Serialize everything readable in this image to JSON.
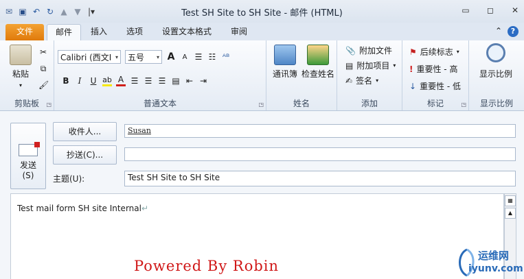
{
  "window": {
    "title": "Test SH Site to SH Site  -  邮件 (HTML)",
    "min_icon": "minimize-icon",
    "max_icon": "maximize-icon",
    "close_icon": "close-icon"
  },
  "quick_access": [
    "mail-icon",
    "save-icon",
    "undo-icon",
    "redo-icon",
    "up-icon",
    "down-icon",
    "customize-icon"
  ],
  "tabs": {
    "file": "文件",
    "items": [
      "邮件",
      "插入",
      "选项",
      "设置文本格式",
      "审阅"
    ],
    "active": "邮件"
  },
  "ribbon": {
    "clipboard": {
      "label": "剪贴板",
      "paste": "粘贴"
    },
    "basic_text": {
      "label": "普通文本",
      "font": "Calibri (西文I",
      "size": "五号",
      "bold": "B",
      "italic": "I",
      "underline": "U",
      "grow": "A",
      "shrink": "A",
      "highlight": "ab",
      "font_color": "A"
    },
    "names": {
      "label": "姓名",
      "address_book": "通讯簿",
      "check_names": "检查姓名"
    },
    "add": {
      "label": "添加",
      "attach_file": "附加文件",
      "attach_item": "附加项目",
      "signature": "签名"
    },
    "tags": {
      "label": "标记",
      "follow_up": "后续标志",
      "high": "重要性 - 高",
      "low": "重要性 - 低"
    },
    "zoom": {
      "label": "显示比例",
      "zoom": "显示比例"
    }
  },
  "form": {
    "send": "发送",
    "send_key": "(S)",
    "to_button": "收件人...",
    "cc_button": "抄送(C)...",
    "subject_label": "主题(U):",
    "to_value": "Susan",
    "cc_value": "",
    "subject_value": "Test SH Site to SH Site"
  },
  "body": {
    "text": "Test mail form SH site Internal",
    "overlay": "Powered By Robin"
  },
  "watermark": {
    "line1": "运维网",
    "line2": "iyunv.com"
  },
  "colors": {
    "file_tab": "#e07a0b",
    "accent": "#2b6cc4",
    "overlay": "#d01818"
  }
}
